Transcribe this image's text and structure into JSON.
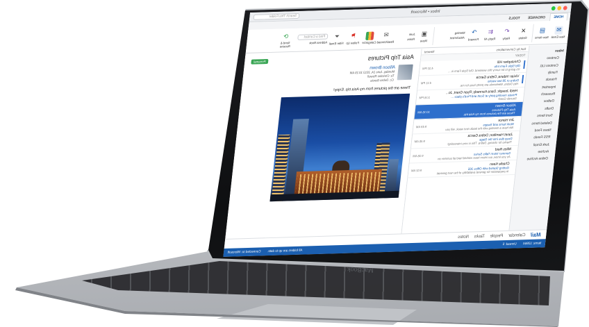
{
  "laptop": {
    "brand": "MacBook"
  },
  "window": {
    "title": "Inbox • Microsoft",
    "search_placeholder": "Search This Folder"
  },
  "ribbon": {
    "tabs": [
      "HOME",
      "ORGANIZE",
      "TOOLS"
    ],
    "buttons": [
      {
        "label": "New Email",
        "icon": "new-email-icon"
      },
      {
        "label": "New Items",
        "icon": "new-items-icon"
      },
      {
        "label": "Delete",
        "icon": "delete-icon"
      },
      {
        "label": "Reply",
        "icon": "reply-icon"
      },
      {
        "label": "Reply All",
        "icon": "reply-all-icon"
      },
      {
        "label": "Forward",
        "icon": "forward-icon"
      },
      {
        "label": "Meeting",
        "icon": "meeting-icon"
      },
      {
        "label": "Attachment",
        "icon": "attachment-icon"
      },
      {
        "label": "Move",
        "icon": "move-icon"
      },
      {
        "label": "Junk",
        "icon": "junk-icon"
      },
      {
        "label": "Rules",
        "icon": "rules-icon"
      },
      {
        "label": "Read/Unread",
        "icon": "envelope-icon"
      },
      {
        "label": "Categorize",
        "icon": "categorize-icon"
      },
      {
        "label": "Follow Up",
        "icon": "flag-icon"
      },
      {
        "label": "Filter Email",
        "icon": "filter-icon"
      },
      {
        "label": "Address Book",
        "icon": "address-book-icon"
      },
      {
        "label": "Send & Receive",
        "icon": "send-receive-icon"
      }
    ],
    "find_contact_placeholder": "Find a Contact"
  },
  "folders": {
    "header": "Inbox",
    "items": [
      {
        "name": "Contoso",
        "count": ""
      },
      {
        "name": "Contoso Ltd.",
        "count": ""
      },
      {
        "name": "Family",
        "count": ""
      },
      {
        "name": "Friends",
        "count": ""
      },
      {
        "name": "Important",
        "count": ""
      },
      {
        "name": "Research",
        "count": ""
      },
      {
        "name": "Outbox",
        "count": ""
      },
      {
        "name": "Drafts",
        "count": ""
      },
      {
        "name": "Sent Items",
        "count": ""
      },
      {
        "name": "Deleted Items",
        "count": ""
      },
      {
        "name": "News Feed",
        "count": ""
      },
      {
        "name": "RSS Feeds",
        "count": ""
      },
      {
        "name": "Junk Email",
        "count": ""
      },
      {
        "name": "Archive",
        "count": ""
      },
      {
        "name": "Online Archive",
        "count": ""
      }
    ]
  },
  "message_list": {
    "sort_label": "Sort by Conversations",
    "sort_order": "Newest",
    "group_header": "TODAY",
    "messages": [
      {
        "from": "Christopher Hill",
        "subject": "Old Style Farm Info",
        "preview": "It's going to be sunny this weekend. Old Style Farm is ...",
        "time": "4:32 PM",
        "selected": false,
        "unread": true
      },
      {
        "from": "Vivian Vidana; Debra Garcia",
        "subject": "Debra or Jill two weeks",
        "preview": "Hey Debra, Weekends are pretty busy for me.",
        "time": "4:11 PM",
        "selected": false,
        "unread": true
      },
      {
        "from": "Heidi Joseph; Dana Kennedy; Ryan Grant, Jo...",
        "subject": "Private meeting party at Scott and Fred's place ...",
        "preview": "Sounds Good!",
        "time": "3:26 PM",
        "selected": false,
        "unread": false
      },
      {
        "from": "Allison Brown",
        "subject": "Asia Trip Pictures",
        "preview": "These are the pictures from my Asia trip.",
        "time": "10:15 AM",
        "selected": true,
        "unread": false
      },
      {
        "from": "Jim Hance",
        "subject": "Work items and Swaps",
        "preview": "We have a meeting with the leads next week, will you",
        "time": "9:49 AM",
        "selected": false,
        "unread": false
      },
      {
        "from": "Janet Hamilton; Debra Garcia",
        "subject": "Deep dive into the Stage",
        "preview": "Thanks for sharing, Debra. This is very interesting!",
        "time": "9:45 AM",
        "selected": false,
        "unread": false
      },
      {
        "from": "Miles Reid",
        "subject": "Summer Intern Talks Series",
        "preview": "As you know, our intern have worked hard all summer on",
        "time": "9:38 AM",
        "selected": false,
        "unread": false
      },
      {
        "from": "Charlie Keen",
        "subject": "Getting Started with Office 365",
        "preview": "In preparation for general availability of the next generati",
        "time": "9:02 AM",
        "selected": false,
        "unread": false
      }
    ]
  },
  "reading_pane": {
    "subject": "Asia Trip Pictures",
    "tag": "Personal",
    "sender": "Allison Brown",
    "date": "Monday, June 24, 2013 10:15 AM",
    "to": "To: Christine Rowell",
    "cc": "Cc: Debra Garcia",
    "body": "These are the pictures from my Asia trip.  Enjoy!"
  },
  "navigation": [
    "Mail",
    "Calendar",
    "People",
    "Tasks",
    "Notes"
  ],
  "status": {
    "items": "Items: 12864",
    "unread": "Unread: 5",
    "sync": "All folders are up to date.",
    "connection": "Connected to: Microsoft"
  },
  "colors": {
    "accent": "#1b5fb0",
    "selection": "#2e6fcc",
    "tag": "#3aa655",
    "status_bar": "#1b5fb0"
  }
}
